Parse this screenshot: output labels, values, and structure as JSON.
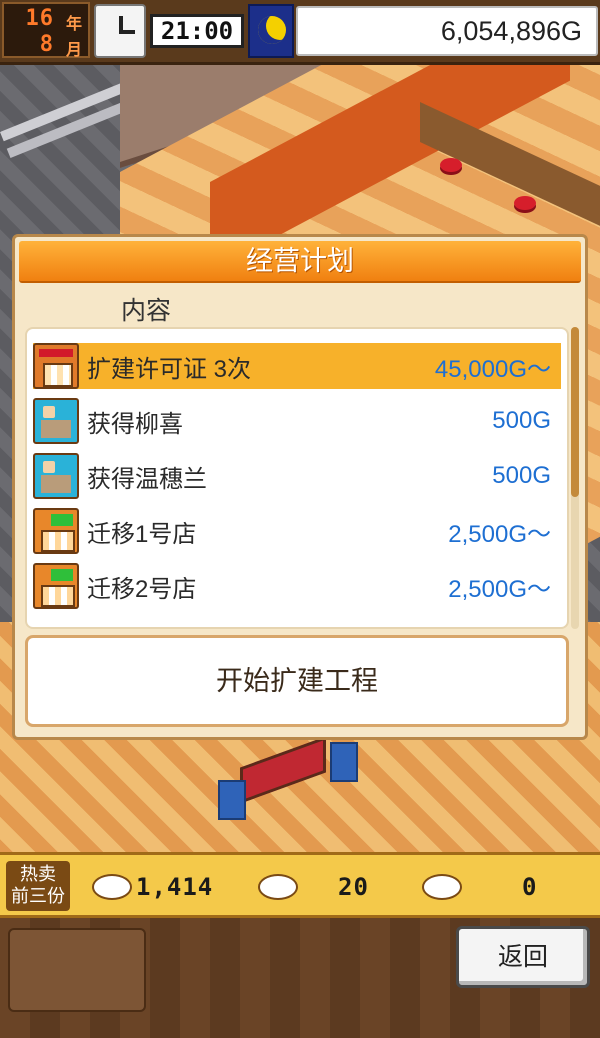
{
  "status": {
    "year": "16",
    "year_unit": "年",
    "month": "8",
    "month_unit": "月",
    "time": "21:00",
    "money": "6,054,896G"
  },
  "dialog": {
    "title": "经营计划",
    "content_label": "内容",
    "items": [
      {
        "label": "扩建许可证 3次",
        "price": "45,000G～",
        "icon": "shop-expand-icon",
        "selected": true
      },
      {
        "label": "获得柳喜",
        "price": "500G",
        "icon": "staff-icon",
        "selected": false
      },
      {
        "label": "获得温穗兰",
        "price": "500G",
        "icon": "staff-icon",
        "selected": false
      },
      {
        "label": "迁移1号店",
        "price": "2,500G～",
        "icon": "shop-move-icon",
        "selected": false
      },
      {
        "label": "迁移2号店",
        "price": "2,500G～",
        "icon": "shop-move-icon",
        "selected": false
      }
    ],
    "start_button": "开始扩建工程"
  },
  "bestsellers": {
    "label_line1": "热卖",
    "label_line2": "前三份",
    "items": [
      {
        "count": "1,414",
        "icon": "dish-icon"
      },
      {
        "count": "20",
        "icon": "noodle-bowl-icon"
      },
      {
        "count": "0",
        "icon": "plate-icon"
      }
    ]
  },
  "back_button": "返回",
  "colors": {
    "title_orange": "#f08010",
    "selected_row": "#f7b12a",
    "price_blue": "#1e6fd2"
  }
}
